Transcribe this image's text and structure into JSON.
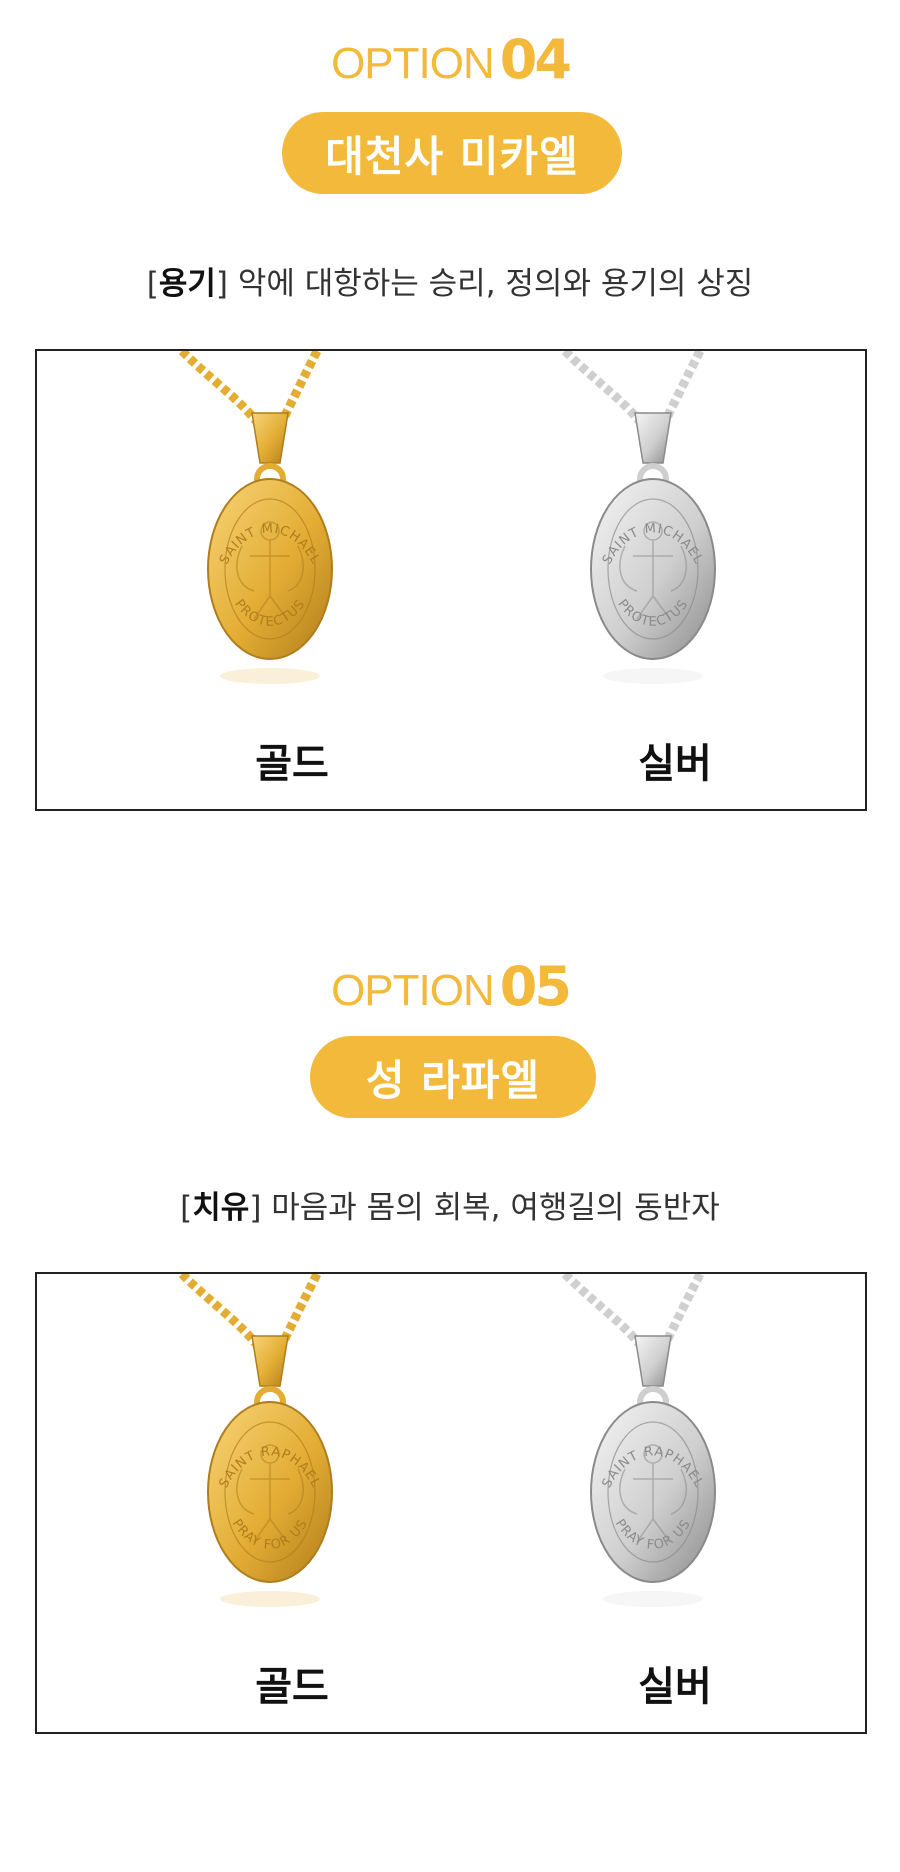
{
  "colors": {
    "accent": "#f2b93a",
    "gold_light": "#f7d478",
    "gold_mid": "#e3ad34",
    "gold_dark": "#b07d1c",
    "silver_light": "#f4f4f4",
    "silver_mid": "#cfcfcf",
    "silver_dark": "#8a8a8a"
  },
  "options": [
    {
      "option_word": "OPTION",
      "option_number": "04",
      "name": "대천사 미카엘",
      "desc_keyword": "용기",
      "desc_text": "악에 대항하는 승리, 정의와 용기의 상징",
      "medal_top": "SAINT MICHAEL",
      "medal_bottom": "PROTECTUS",
      "products": [
        {
          "label": "골드",
          "finish": "gold-pendant"
        },
        {
          "label": "실버",
          "finish": "silver-pendant"
        }
      ]
    },
    {
      "option_word": "OPTION",
      "option_number": "05",
      "name": "성 라파엘",
      "desc_keyword": "치유",
      "desc_text": "마음과 몸의 회복, 여행길의 동반자",
      "medal_top": "SAINT RAPHAEL",
      "medal_bottom": "PRAY FOR US",
      "products": [
        {
          "label": "골드",
          "finish": "gold-pendant"
        },
        {
          "label": "실버",
          "finish": "silver-pendant"
        }
      ]
    }
  ]
}
